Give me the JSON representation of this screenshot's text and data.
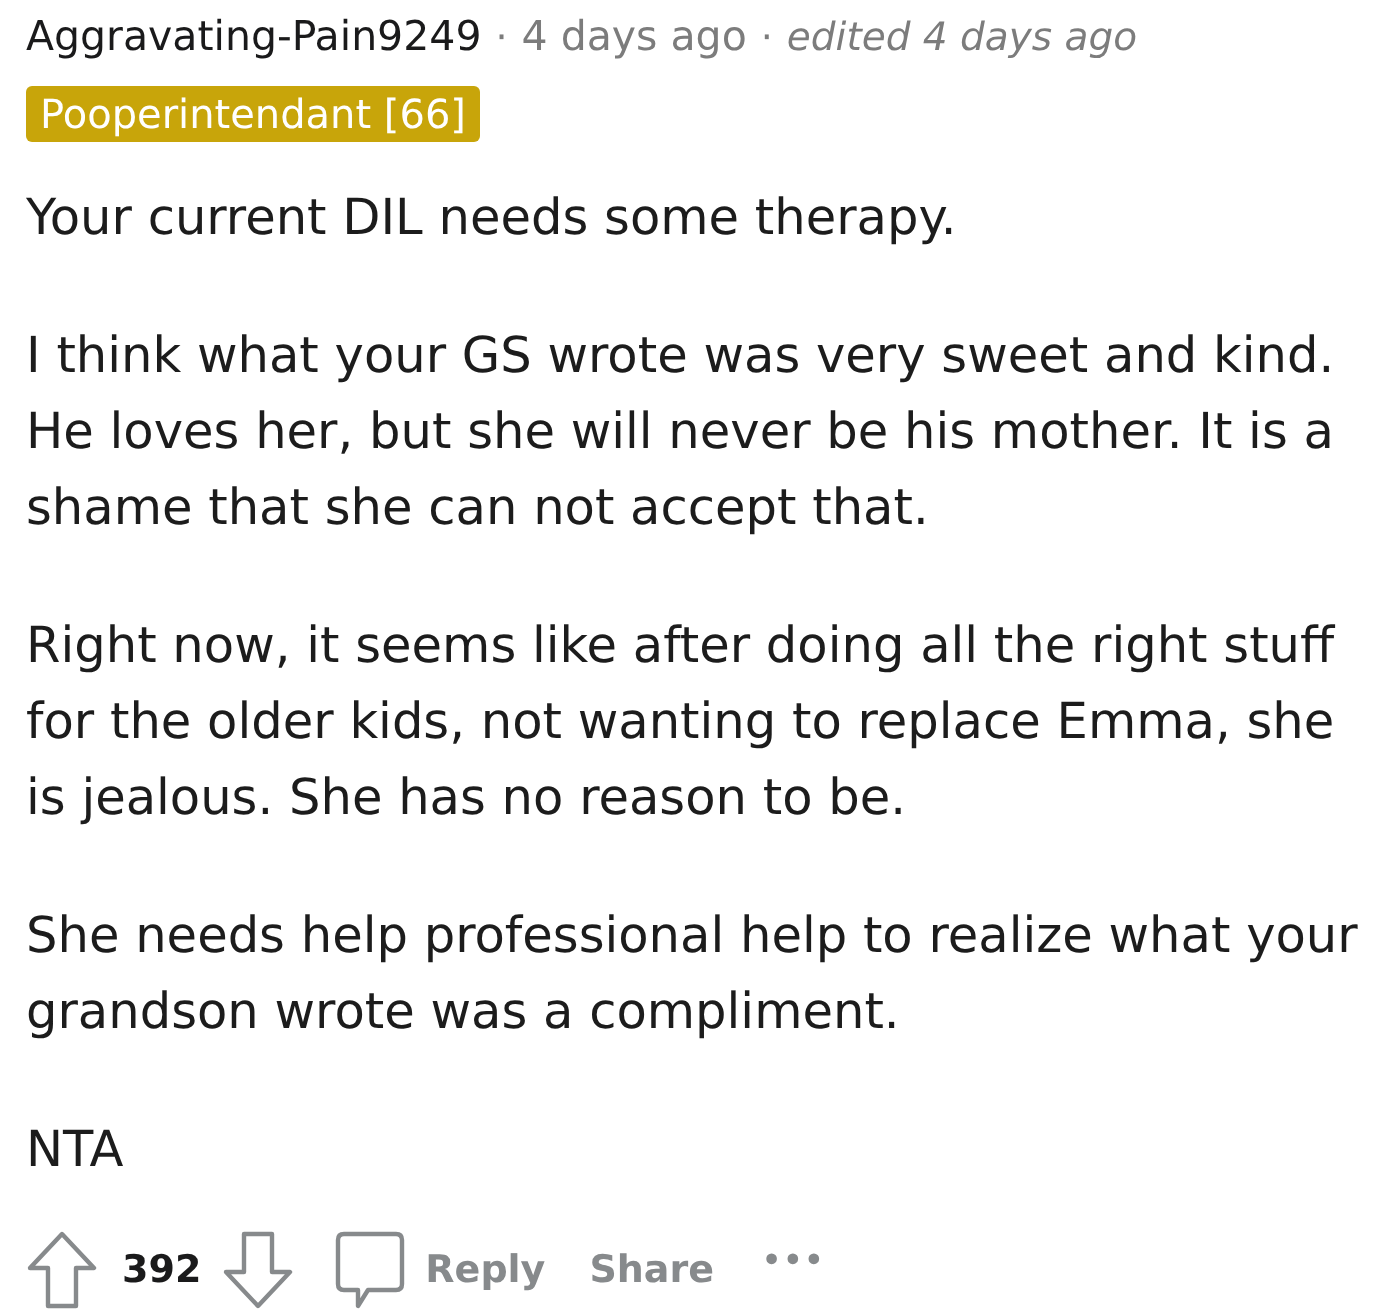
{
  "comment": {
    "author": "Aggravating-Pain9249",
    "meta": [
      {
        "kind": "time",
        "separator": "·",
        "text": "4 days ago"
      },
      {
        "kind": "edited",
        "separator": "·",
        "text": "edited 4 days ago"
      }
    ],
    "flair": "Pooperintendant [66]",
    "paragraphs": [
      "Your current DIL needs some therapy.",
      "I think what your GS wrote was very sweet and kind. He loves her, but she will never be his mother. It is a shame that she can not accept that.",
      "Right now, it seems like after doing all the right stuff for the older kids, not wanting to replace Emma, she is jealous. She has no reason to be.",
      "She needs help professional help to realize what your grandson wrote was a compliment.",
      "NTA"
    ]
  },
  "actions": {
    "score": "392",
    "buttons": [
      {
        "kind": "reply",
        "label": "Reply"
      },
      {
        "kind": "share",
        "label": "Share"
      },
      {
        "kind": "more",
        "label": "•••"
      }
    ]
  }
}
